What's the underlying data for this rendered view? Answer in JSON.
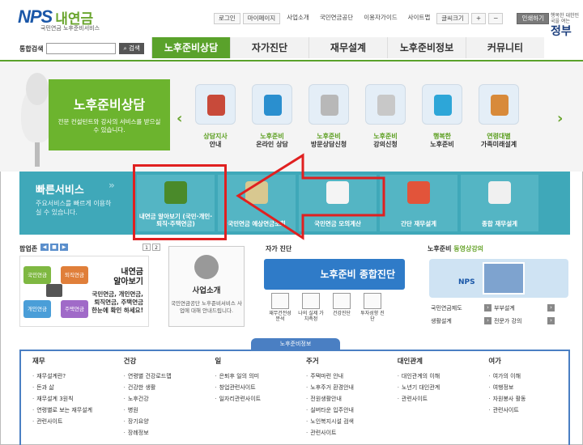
{
  "header": {
    "logo_en": "NPS",
    "logo_kr": "내연금",
    "logo_sub": "국민연금 노후준비서비스",
    "util": [
      "로그인",
      "마이페이지",
      "사업소개",
      "국민연금공단",
      "이용자가이드",
      "사이트맵",
      "글씨크기",
      "+",
      "−",
      "인쇄하기"
    ],
    "gov_small": "행복한 대한민국을 여는",
    "gov_big": "정부",
    "search_label": "통합검색",
    "search_btn": "검색"
  },
  "gnb": [
    "노후준비상담",
    "자가진단",
    "재무설계",
    "노후준비정보",
    "커뮤니티"
  ],
  "hero": {
    "title": "노후준비상담",
    "desc": "전문 컨설턴트와 강사의 서비스를 받으실 수 있습니다.",
    "items": [
      {
        "l1": "상담지사",
        "l2": "안내",
        "color": "#c84a3a"
      },
      {
        "l1": "노후준비",
        "l2": "온라인 상담",
        "color": "#2a8fcf"
      },
      {
        "l1": "노후준비",
        "l2": "방문상담신청",
        "color": "#b8b8b8"
      },
      {
        "l1": "노후준비",
        "l2": "강의신청",
        "color": "#c8c8c8"
      },
      {
        "l1": "행복한",
        "l2": "노후준비",
        "color": "#2da6d8"
      },
      {
        "l1": "연령대별",
        "l2": "가족미래설계",
        "color": "#d88a3a"
      }
    ]
  },
  "quick": {
    "title": "빠른서비스",
    "desc": "주요서비스를 빠르게 이용하실 수 있습니다.",
    "items": [
      {
        "label": "내연금 알아보기 (국민·개인·퇴직·주택연금)",
        "color": "#4a8a2a"
      },
      {
        "label": "국민연금 예상연금조회",
        "color": "#d8c890"
      },
      {
        "label": "국민연금 모의계산",
        "color": "#f4f4f4"
      },
      {
        "label": "간단 재무설계",
        "color": "#e2543a"
      },
      {
        "label": "종합 재무설계",
        "color": "#f0f0f0"
      }
    ]
  },
  "popup": {
    "title": "팝업존",
    "pages": [
      "◀",
      "■",
      "▶",
      "1",
      "2"
    ],
    "badges": [
      {
        "text": "국민연금",
        "color": "#7fb842"
      },
      {
        "text": "퇴직연금",
        "color": "#e07f3a"
      },
      {
        "text": "개인연금",
        "color": "#4a9ed8"
      },
      {
        "text": "주택연금",
        "color": "#a06ac8"
      }
    ],
    "headline_1": "내연금",
    "headline_2": "알아보기",
    "sub_1": "국민연금, 개인연금,",
    "sub_2": "퇴직연금, 주택연금",
    "sub_3": "한눈에 확인 하세요!"
  },
  "biz": {
    "title": "사업소개",
    "desc": "국민연금공단 노후준비서비스 사업에 대해 안내드립니다."
  },
  "diag": {
    "title": "자가 진단",
    "button": "노후준비 종합진단",
    "items": [
      "재무건전성 분석",
      "나의 실제 가치측정",
      "건강진단",
      "투자성향 진단"
    ]
  },
  "lecture": {
    "title_a": "노후준비 ",
    "title_b": "동영상강의",
    "nps": "NPS",
    "links": [
      "국민연금제도",
      "부부설계",
      "생활설계",
      "전문가 강의"
    ]
  },
  "info": {
    "tab": "노후준비정보",
    "columns": [
      {
        "title": "재무",
        "items": [
          "재무설계란?",
          "돈과 삶",
          "재무설계 3원칙",
          "연령별로 보는 재무설계",
          "관련사이트"
        ]
      },
      {
        "title": "건강",
        "items": [
          "연령별 건강로드맵",
          "건강한 생활",
          "노후건강",
          "병원",
          "장기요양",
          "장례정보"
        ]
      },
      {
        "title": "일",
        "items": [
          "은퇴후 일의 의미",
          "창업관련사이트",
          "일자리관련사이트"
        ]
      },
      {
        "title": "주거",
        "items": [
          "주택마련 안내",
          "노후주거 환경안내",
          "전원생활안내",
          "실버타운 입주안내",
          "노인복지시설 검색",
          "관련사이트"
        ]
      },
      {
        "title": "대인관계",
        "items": [
          "대인관계의 이해",
          "노년기 대인관계",
          "관련사이트"
        ]
      },
      {
        "title": "여가",
        "items": [
          "여가의 이해",
          "여행정보",
          "자원봉사 활동",
          "관련사이트"
        ]
      }
    ]
  }
}
